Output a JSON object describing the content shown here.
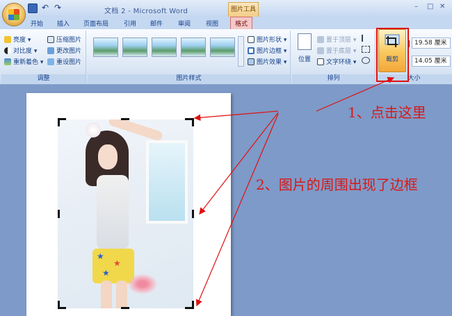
{
  "window": {
    "title": "文档 2 - Microsoft Word",
    "context_tool": "图片工具",
    "minimize": "–",
    "maximize": "□",
    "close": "✕",
    "inner_close": "✕"
  },
  "tabs": [
    "开始",
    "插入",
    "页面布局",
    "引用",
    "邮件",
    "审阅",
    "视图",
    "格式"
  ],
  "active_tab": "格式",
  "groups": {
    "adjust": {
      "label": "调整",
      "items": [
        "亮度 ▾",
        "对比度 ▾",
        "重新着色 ▾",
        "压缩图片",
        "更改图片",
        "重设图片"
      ]
    },
    "picture_styles": {
      "label": "图片样式",
      "items": [
        "图片形状 ▾",
        "图片边框 ▾",
        "图片效果 ▾"
      ]
    },
    "arrange": {
      "label": "排列",
      "position": "位置",
      "items": [
        "置于顶层 ▾",
        "置于底层 ▾",
        "文字环绕 ▾"
      ]
    },
    "size": {
      "label": "大小",
      "crop": "裁剪",
      "height": "19.58 厘米",
      "width": "14.05 厘米"
    }
  },
  "annotations": {
    "step1": "1、点击这里",
    "step2": "2、图片的周围出现了边框"
  },
  "colors": {
    "accent_red": "#e01010",
    "annotation_red": "#d81818",
    "ribbon_bg": "#dce7f5"
  }
}
